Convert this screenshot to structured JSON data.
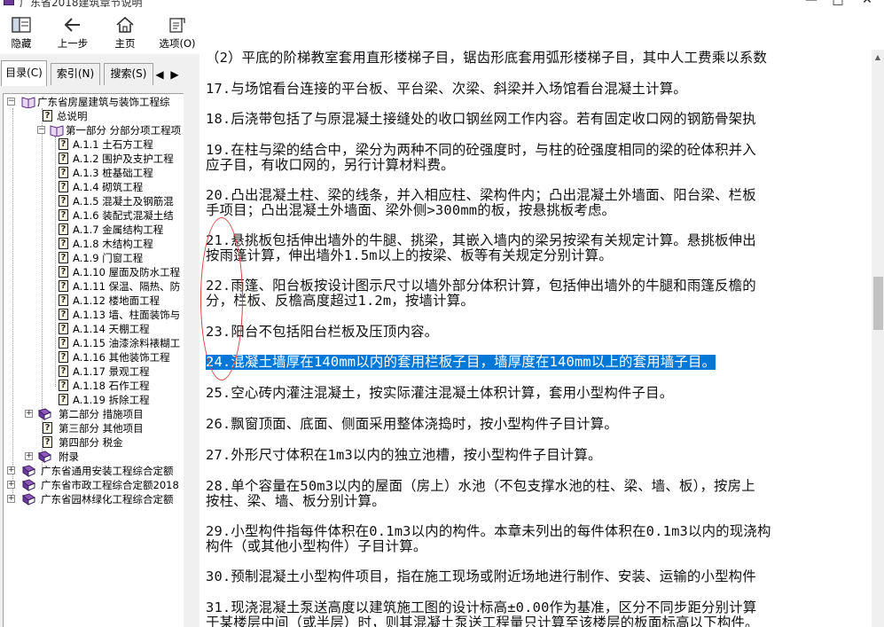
{
  "window": {
    "title": "广东省2018建筑章节说明",
    "controls": [
      "—",
      "□",
      "✕"
    ]
  },
  "toolbar": {
    "hide": "隐藏",
    "back": "上一步",
    "home": "主页",
    "options": "选项(O)"
  },
  "tabs": {
    "contents": "目录(C)",
    "index": "索引(N)",
    "search": "搜索(S)",
    "prev": "◀",
    "next": "▶"
  },
  "tree": {
    "root": "广东省房屋建筑与装饰工程综",
    "overview": "总说明",
    "part1": "第一部分  分部分项工程项",
    "a11": "A.1.1  土石方工程",
    "a12": "A.1.2  围护及支护工程",
    "a13": "A.1.3  桩基础工程",
    "a14": "A.1.4  砌筑工程",
    "a15": "A.1.5  混凝土及钢筋混",
    "a16": "A.1.6  装配式混凝土结",
    "a17": "A.1.7  金属结构工程",
    "a18": "A.1.8  木结构工程",
    "a19": "A.1.9  门窗工程",
    "a110": "A.1.10  屋面及防水工程",
    "a111": "A.1.11  保温、隔热、防",
    "a112": "A.1.12  楼地面工程",
    "a113": "A.1.13  墙、柱面装饰与",
    "a114": "A.1.14  天棚工程",
    "a115": "A.1.15  油漆涂料裱糊工",
    "a116": "A.1.16  其他装饰工程",
    "a117": "A.1.17  景观工程",
    "a118": "A.1.18  石作工程",
    "a119": "A.1.19  拆除工程",
    "part2": "第二部分  措施项目",
    "part3": "第三部分  其他项目",
    "part4": "第四部分  税金",
    "appendix": "附录",
    "install": "广东省通用安装工程综合定额",
    "municipal": "广东省市政工程综合定额2018",
    "garden": "广东省园林绿化工程综合定额"
  },
  "content": {
    "p16": "（2）平底的阶梯教室套用直形楼梯子目，锯齿形底套用弧形楼梯子目，其中人工费乘以系数",
    "p17": "17.与场馆看台连接的平台板、平台梁、次梁、斜梁并入场馆看台混凝土计算。",
    "p18": "18.后浇带包括了与原混凝土接缝处的收口钢丝网工作内容。若有固定收口网的钢筋骨架执",
    "p19a": "19.在柱与梁的结合中，梁分为两种不同的砼强度时，与柱的砼强度相同的梁的砼体积并入",
    "p19b": "应子目，有收口网的，另行计算材料费。",
    "p20a": "20.凸出混凝土柱、梁的线条，并入相应柱、梁构件内；凸出混凝土外墙面、阳台梁、栏板",
    "p20b": "手项目；凸出混凝土外墙面、梁外侧>300mm的板，按悬挑板考虑。",
    "p21a": "21.悬挑板包括伸出墙外的牛腿、挑梁，其嵌入墙内的梁另按梁有关规定计算。悬挑板伸出",
    "p21b": "按雨篷计算，伸出墙外1.5m以上的按梁、板等有关规定分别计算。",
    "p22a": "22.雨篷、阳台板按设计图示尺寸以墙外部分体积计算，包括伸出墙外的牛腿和雨篷反檐的",
    "p22b": "分，栏板、反檐高度超过1.2m，按墙计算。",
    "p23": "23.阳台不包括阳台栏板及压顶内容。",
    "p24": "24.混凝土墙厚在140mm以内的套用栏板子目，墙厚度在140mm以上的套用墙子目。",
    "p25": "25.空心砖内灌注混凝土，按实际灌注混凝土体积计算，套用小型构件子目。",
    "p26": "26.飘窗顶面、底面、侧面采用整体浇捣时，按小型构件子目计算。",
    "p27": "27.外形尺寸体积在1m3以内的独立池槽，按小型构件子目计算。",
    "p28a": "28.单个容量在50m3以内的屋面（房上）水池（不包支撑水池的柱、梁、墙、板），按房上",
    "p28b": "按柱、梁、墙、板分别计算。",
    "p29a": "29.小型构件指每件体积在0.1m3以内的构件。本章未列出的每件体积在0.1m3以内的现浇构",
    "p29b": "构件（或其他小型构件）子目计算。",
    "p30": "30.预制混凝土小型构件项目，指在施工现场或附近场地进行制作、安装、运输的小型构件",
    "p31a": "31.现浇混凝土泵送高度以建筑施工图的设计标高±0.00作为基准，区分不同步距分别计算",
    "p31b": "于某楼层中间（或半层）时，则其混凝土泵送工程量只计算至该楼层的板面标高以下构件。"
  },
  "colors": {
    "selection": "#0078d7",
    "annotation": "#e04040",
    "book": "#6b3a9a"
  }
}
